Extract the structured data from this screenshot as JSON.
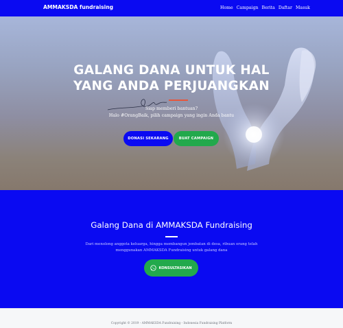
{
  "navbar": {
    "brand": "AMMAKSDA fundraising",
    "links": [
      "Home",
      "Campaign",
      "Berita",
      "Daftar",
      "Masuk"
    ]
  },
  "hero": {
    "title_line1": "GALANG DANA UNTUK HAL",
    "title_line2": "YANG ANDA PERJUANGKAN",
    "subtitle_line1": "Siap memberi bantuan?",
    "subtitle_line2": "Halo #OrangBaik, pilih campaign yang ingin Anda bantu",
    "donate_button": "DONASI SEKARANG",
    "create_button": "BUAT CAMPAIGN"
  },
  "about": {
    "title": "Galang Dana di AMMAKSDA Fundraising",
    "desc_line1": "Dari menolong anggota keluarga, hingga membangun jembatan di desa, ribuan orang telah",
    "desc_line2": "menggunakan AMMAKSDA Fundraising untuk galang dana",
    "consult_button": "KONSULTASIKAN",
    "consult_icon": "whatsapp-icon"
  },
  "footer": {
    "copyright": "Copyright © 2019 - AMMAKSDA Fundraising - Indonesia Fundraising Platform"
  },
  "colors": {
    "primary_blue": "#0a0af2",
    "accent_green": "#22a94c",
    "accent_red": "#e8553a"
  }
}
